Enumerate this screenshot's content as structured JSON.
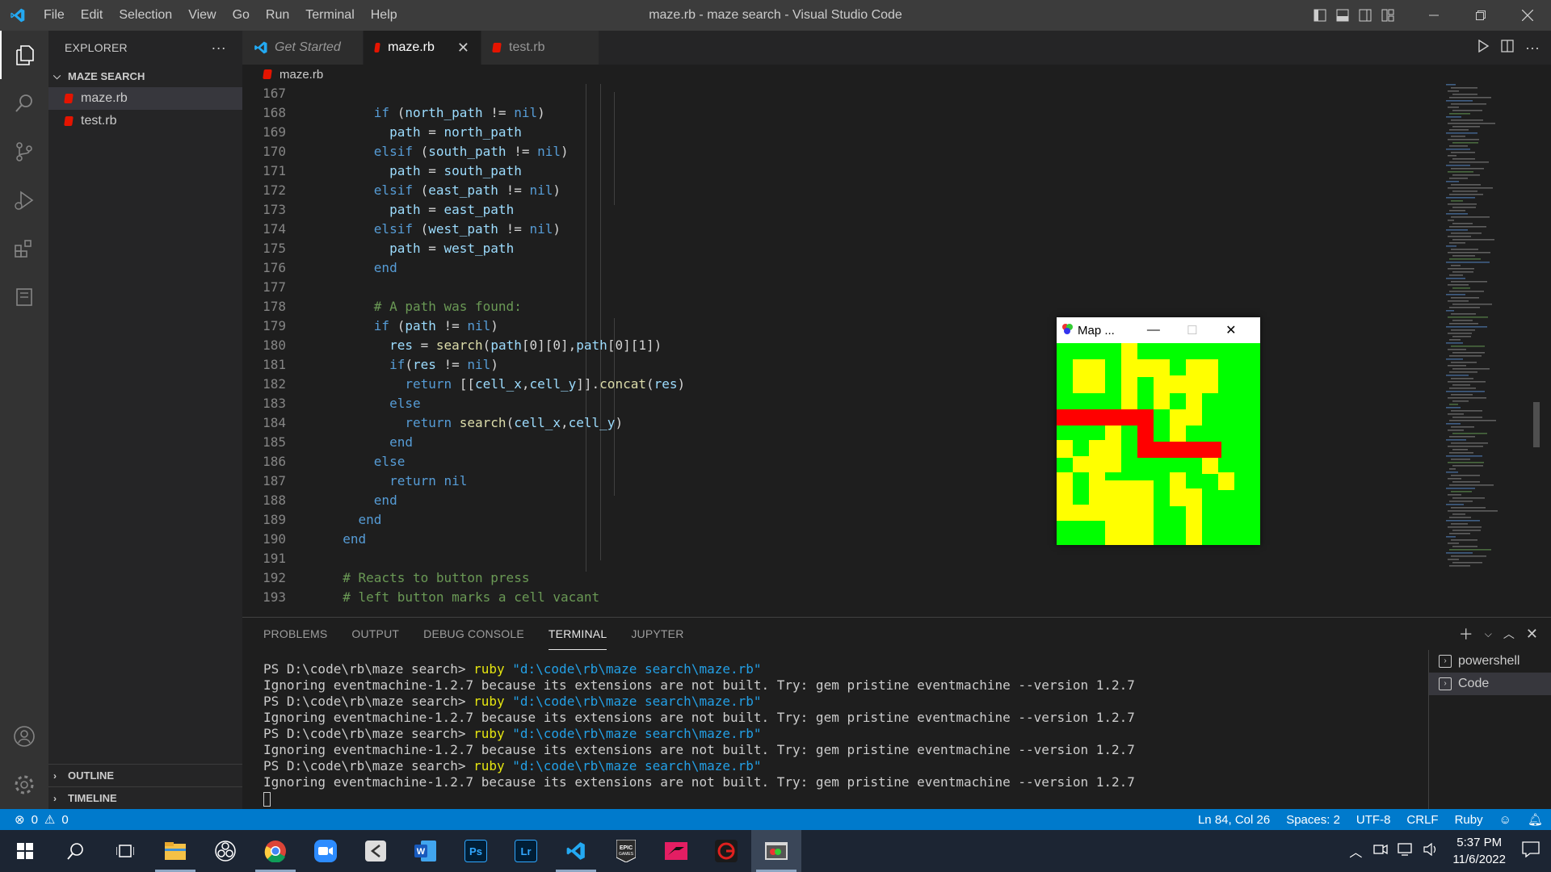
{
  "window": {
    "title": "maze.rb - maze search - Visual Studio Code"
  },
  "menu": [
    "File",
    "Edit",
    "Selection",
    "View",
    "Go",
    "Run",
    "Terminal",
    "Help"
  ],
  "sidebar": {
    "header": "EXPLORER",
    "folder": "MAZE SEARCH",
    "files": [
      {
        "name": "maze.rb"
      },
      {
        "name": "test.rb"
      }
    ],
    "outline": "OUTLINE",
    "timeline": "TIMELINE"
  },
  "tabs": [
    {
      "label": "Get Started"
    },
    {
      "label": "maze.rb"
    },
    {
      "label": "test.rb"
    }
  ],
  "breadcrumb": "maze.rb",
  "code": [
    {
      "n": "167",
      "t": []
    },
    {
      "n": "168",
      "t": [
        [
          "      ",
          ""
        ],
        [
          "if",
          "kw"
        ],
        [
          " (",
          "op"
        ],
        [
          "north_path",
          "id"
        ],
        [
          " != ",
          "op"
        ],
        [
          "nil",
          "kw"
        ],
        [
          ")",
          "op"
        ]
      ]
    },
    {
      "n": "169",
      "t": [
        [
          "        ",
          ""
        ],
        [
          "path",
          "id"
        ],
        [
          " = ",
          "op"
        ],
        [
          "north_path",
          "id"
        ]
      ]
    },
    {
      "n": "170",
      "t": [
        [
          "      ",
          ""
        ],
        [
          "elsif",
          "kw"
        ],
        [
          " (",
          "op"
        ],
        [
          "south_path",
          "id"
        ],
        [
          " != ",
          "op"
        ],
        [
          "nil",
          "kw"
        ],
        [
          ")",
          "op"
        ]
      ]
    },
    {
      "n": "171",
      "t": [
        [
          "        ",
          ""
        ],
        [
          "path",
          "id"
        ],
        [
          " = ",
          "op"
        ],
        [
          "south_path",
          "id"
        ]
      ]
    },
    {
      "n": "172",
      "t": [
        [
          "      ",
          ""
        ],
        [
          "elsif",
          "kw"
        ],
        [
          " (",
          "op"
        ],
        [
          "east_path",
          "id"
        ],
        [
          " != ",
          "op"
        ],
        [
          "nil",
          "kw"
        ],
        [
          ")",
          "op"
        ]
      ]
    },
    {
      "n": "173",
      "t": [
        [
          "        ",
          ""
        ],
        [
          "path",
          "id"
        ],
        [
          " = ",
          "op"
        ],
        [
          "east_path",
          "id"
        ]
      ]
    },
    {
      "n": "174",
      "t": [
        [
          "      ",
          ""
        ],
        [
          "elsif",
          "kw"
        ],
        [
          " (",
          "op"
        ],
        [
          "west_path",
          "id"
        ],
        [
          " != ",
          "op"
        ],
        [
          "nil",
          "kw"
        ],
        [
          ")",
          "op"
        ]
      ]
    },
    {
      "n": "175",
      "t": [
        [
          "        ",
          ""
        ],
        [
          "path",
          "id"
        ],
        [
          " = ",
          "op"
        ],
        [
          "west_path",
          "id"
        ]
      ]
    },
    {
      "n": "176",
      "t": [
        [
          "      ",
          ""
        ],
        [
          "end",
          "kw"
        ]
      ]
    },
    {
      "n": "177",
      "t": []
    },
    {
      "n": "178",
      "t": [
        [
          "      ",
          ""
        ],
        [
          "# A path was found:",
          "cm"
        ]
      ]
    },
    {
      "n": "179",
      "t": [
        [
          "      ",
          ""
        ],
        [
          "if",
          "kw"
        ],
        [
          " (",
          "op"
        ],
        [
          "path",
          "id"
        ],
        [
          " != ",
          "op"
        ],
        [
          "nil",
          "kw"
        ],
        [
          ")",
          "op"
        ]
      ]
    },
    {
      "n": "180",
      "t": [
        [
          "        ",
          ""
        ],
        [
          "res",
          "id"
        ],
        [
          " = ",
          "op"
        ],
        [
          "search",
          "fn"
        ],
        [
          "(",
          "op"
        ],
        [
          "path",
          "id"
        ],
        [
          "[0][0],",
          "op"
        ],
        [
          "path",
          "id"
        ],
        [
          "[0][1])",
          "op"
        ]
      ]
    },
    {
      "n": "181",
      "t": [
        [
          "        ",
          ""
        ],
        [
          "if",
          "kw"
        ],
        [
          "(",
          "op"
        ],
        [
          "res",
          "id"
        ],
        [
          " != ",
          "op"
        ],
        [
          "nil",
          "kw"
        ],
        [
          ")",
          "op"
        ]
      ]
    },
    {
      "n": "182",
      "t": [
        [
          "          ",
          ""
        ],
        [
          "return",
          "kw"
        ],
        [
          " [[",
          "op"
        ],
        [
          "cell_x",
          "id"
        ],
        [
          ",",
          "op"
        ],
        [
          "cell_y",
          "id"
        ],
        [
          "]].",
          "op"
        ],
        [
          "concat",
          "fn"
        ],
        [
          "(",
          "op"
        ],
        [
          "res",
          "id"
        ],
        [
          ")",
          "op"
        ]
      ]
    },
    {
      "n": "183",
      "t": [
        [
          "        ",
          ""
        ],
        [
          "else",
          "kw"
        ]
      ]
    },
    {
      "n": "184",
      "t": [
        [
          "          ",
          ""
        ],
        [
          "return",
          "kw"
        ],
        [
          " ",
          "op"
        ],
        [
          "search",
          "fn"
        ],
        [
          "(",
          "op"
        ],
        [
          "cell_x",
          "id"
        ],
        [
          ",",
          "op"
        ],
        [
          "cell_y",
          "id"
        ],
        [
          ")",
          "op"
        ]
      ]
    },
    {
      "n": "185",
      "t": [
        [
          "        ",
          ""
        ],
        [
          "end",
          "kw"
        ]
      ]
    },
    {
      "n": "186",
      "t": [
        [
          "      ",
          ""
        ],
        [
          "else",
          "kw"
        ]
      ]
    },
    {
      "n": "187",
      "t": [
        [
          "        ",
          ""
        ],
        [
          "return",
          "kw"
        ],
        [
          " ",
          "op"
        ],
        [
          "nil",
          "kw"
        ]
      ]
    },
    {
      "n": "188",
      "t": [
        [
          "      ",
          ""
        ],
        [
          "end",
          "kw"
        ]
      ]
    },
    {
      "n": "189",
      "t": [
        [
          "    ",
          ""
        ],
        [
          "end",
          "kw"
        ]
      ]
    },
    {
      "n": "190",
      "t": [
        [
          "  ",
          ""
        ],
        [
          "end",
          "kw"
        ]
      ]
    },
    {
      "n": "191",
      "t": []
    },
    {
      "n": "192",
      "t": [
        [
          "  ",
          ""
        ],
        [
          "# Reacts to button press",
          "cm"
        ]
      ]
    },
    {
      "n": "193",
      "t": [
        [
          "  ",
          ""
        ],
        [
          "# left button marks a cell vacant",
          "cm"
        ]
      ]
    }
  ],
  "panel": {
    "tabs": [
      "PROBLEMS",
      "OUTPUT",
      "DEBUG CONSOLE",
      "TERMINAL",
      "JUPYTER"
    ],
    "active_tab": "TERMINAL",
    "terminal_lines": [
      {
        "prompt": "PS D:\\code\\rb\\maze search> ",
        "cmd": "ruby",
        "arg": " \"d:\\code\\rb\\maze search\\maze.rb\""
      },
      {
        "text": "Ignoring eventmachine-1.2.7 because its extensions are not built. Try: gem pristine eventmachine --version 1.2.7"
      },
      {
        "prompt": "PS D:\\code\\rb\\maze search> ",
        "cmd": "ruby",
        "arg": " \"d:\\code\\rb\\maze search\\maze.rb\""
      },
      {
        "text": "Ignoring eventmachine-1.2.7 because its extensions are not built. Try: gem pristine eventmachine --version 1.2.7"
      },
      {
        "prompt": "PS D:\\code\\rb\\maze search> ",
        "cmd": "ruby",
        "arg": " \"d:\\code\\rb\\maze search\\maze.rb\""
      },
      {
        "text": "Ignoring eventmachine-1.2.7 because its extensions are not built. Try: gem pristine eventmachine --version 1.2.7"
      },
      {
        "prompt": "PS D:\\code\\rb\\maze search> ",
        "cmd": "ruby",
        "arg": " \"d:\\code\\rb\\maze search\\maze.rb\""
      },
      {
        "text": "Ignoring eventmachine-1.2.7 because its extensions are not built. Try: gem pristine eventmachine --version 1.2.7"
      }
    ],
    "terminals": [
      {
        "label": "powershell"
      },
      {
        "label": "Code"
      }
    ]
  },
  "status": {
    "errors": "0",
    "warnings": "0",
    "position": "Ln 84, Col 26",
    "spaces": "Spaces: 2",
    "encoding": "UTF-8",
    "eol": "CRLF",
    "language": "Ruby"
  },
  "map_window": {
    "title": "Map ...",
    "legend_colors": {
      "vacant": "#00ff00",
      "wall": "#ffff00",
      "path": "#ff0000"
    }
  },
  "taskbar": {
    "time": "5:37 PM",
    "date": "11/6/2022",
    "apps": [
      "start-icon",
      "search-icon",
      "task-view-icon",
      "file-explorer-icon",
      "obs-icon",
      "chrome-icon",
      "zoom-icon",
      "unity-icon",
      "word-icon",
      "photoshop-icon",
      "lightroom-icon",
      "vscode-icon",
      "epic-games-icon",
      "forza-icon",
      "garena-icon",
      "ruby-window-icon"
    ]
  },
  "colors": {
    "accent": "#007acc",
    "titlebar": "#3c3c3c",
    "activity": "#333333",
    "sidebar": "#252526",
    "editor": "#1e1e1e"
  }
}
